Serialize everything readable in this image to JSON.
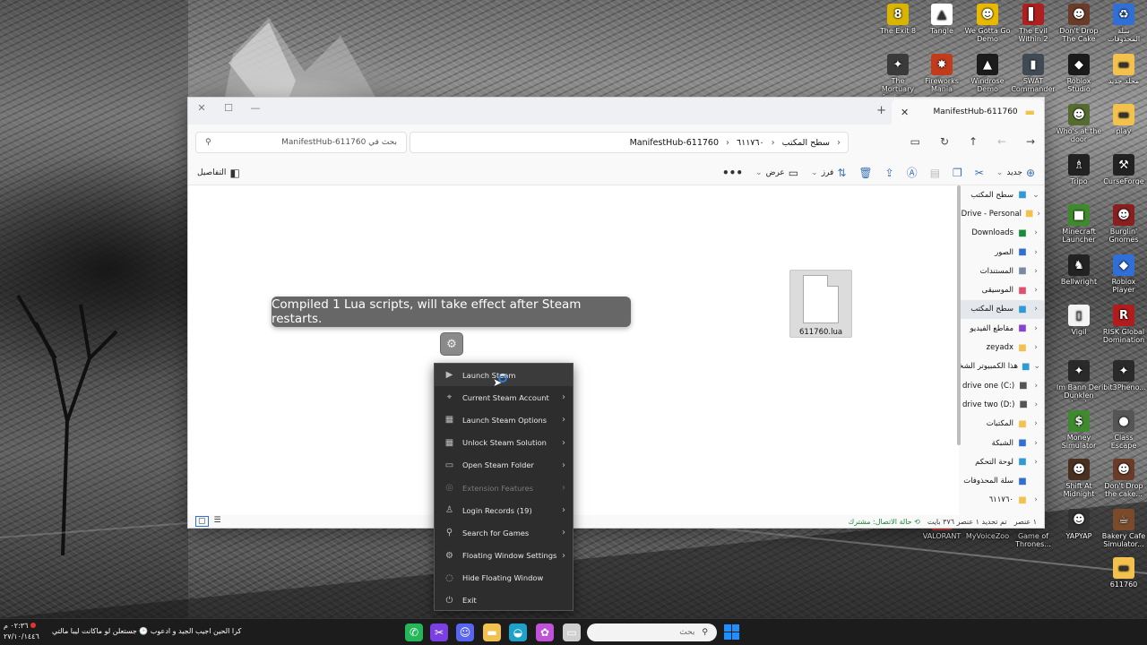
{
  "desktop": {
    "icons": [
      {
        "label": "The Exit 8",
        "glyph": "8",
        "color": "#d9b400",
        "col": 0,
        "row": 0
      },
      {
        "label": "Tangle",
        "glyph": "▲",
        "color": "#ffffff",
        "col": 1,
        "row": 0
      },
      {
        "label": "We Gotta Go Demo",
        "glyph": "☻",
        "color": "#e8b900",
        "col": 2,
        "row": 0
      },
      {
        "label": "The Evil Within 2",
        "glyph": "▌",
        "color": "#b01e1e",
        "col": 3,
        "row": 0
      },
      {
        "label": "Don't Drop The Cake",
        "glyph": "☻",
        "color": "#6b3b2a",
        "col": 4,
        "row": 0
      },
      {
        "label": "سلة المحذوفات",
        "glyph": "♻",
        "color": "#2f6fd6",
        "col": 5,
        "row": 0
      },
      {
        "label": "The Mortuary Assistant",
        "glyph": "✦",
        "color": "#3a3a3a",
        "col": 0,
        "row": 1
      },
      {
        "label": "Fireworks Mania",
        "glyph": "✸",
        "color": "#c23b1b",
        "col": 1,
        "row": 1
      },
      {
        "label": "Windrose Demo",
        "glyph": "▲",
        "color": "#1c1c1c",
        "col": 2,
        "row": 1
      },
      {
        "label": "SWAT Commander",
        "glyph": "▮",
        "color": "#3f4a55",
        "col": 3,
        "row": 1
      },
      {
        "label": "Roblox Studio",
        "glyph": "◆",
        "color": "#1b1b1b",
        "col": 4,
        "row": 1
      },
      {
        "label": "مجلد جديد",
        "glyph": "▬",
        "color": "#f2c14e",
        "col": 5,
        "row": 1
      },
      {
        "label": "Who's at the door",
        "glyph": "☻",
        "color": "#556b2f",
        "col": 4,
        "row": 2
      },
      {
        "label": "play",
        "glyph": "▬",
        "color": "#f2c14e",
        "col": 5,
        "row": 2
      },
      {
        "label": "Tripo",
        "glyph": "♗",
        "color": "#222222",
        "col": 4,
        "row": 3
      },
      {
        "label": "CurseForge",
        "glyph": "⚒",
        "color": "#222222",
        "col": 5,
        "row": 3
      },
      {
        "label": "Minecraft Launcher",
        "glyph": "■",
        "color": "#3e8a2c",
        "col": 4,
        "row": 4
      },
      {
        "label": "Burglin' Gnomes",
        "glyph": "☻",
        "color": "#8a1f1f",
        "col": 5,
        "row": 4
      },
      {
        "label": "Bellwright",
        "glyph": "♞",
        "color": "#222222",
        "col": 4,
        "row": 5
      },
      {
        "label": "Roblox Player",
        "glyph": "◆",
        "color": "#2f6fd6",
        "col": 5,
        "row": 5
      },
      {
        "label": "Vigil",
        "glyph": "▯",
        "color": "#f4f4f4",
        "col": 4,
        "row": 6
      },
      {
        "label": "RISK Global Domination",
        "glyph": "R",
        "color": "#b31c1c",
        "col": 5,
        "row": 6
      },
      {
        "label": "Im Bann Der Dunklen Jagd",
        "glyph": "✦",
        "color": "#2a2a2a",
        "col": 4,
        "row": 7
      },
      {
        "label": "ibit3Pheno...",
        "glyph": "✦",
        "color": "#2a2a2a",
        "col": 5,
        "row": 7
      },
      {
        "label": "Money Simulator",
        "glyph": "$",
        "color": "#3f8a2f",
        "col": 4,
        "row": 8
      },
      {
        "label": "Class Escape",
        "glyph": "●",
        "color": "#555555",
        "col": 5,
        "row": 8
      },
      {
        "label": "Shift At Midnight",
        "glyph": "☻",
        "color": "#4a3020",
        "col": 4,
        "row": 9
      },
      {
        "label": "Don't Drop the cake...",
        "glyph": "☻",
        "color": "#6b3b2a",
        "col": 5,
        "row": 9
      },
      {
        "label": "VALORANT",
        "glyph": "V",
        "color": "#d13b3b",
        "col": 1,
        "row": 10
      },
      {
        "label": "MyVoiceZoo",
        "glyph": "◉",
        "color": "#444444",
        "col": 2,
        "row": 10
      },
      {
        "label": "Game of Thrones...",
        "glyph": "♜",
        "color": "#333333",
        "col": 3,
        "row": 10
      },
      {
        "label": "YAPYAP",
        "glyph": "☻",
        "color": "#333333",
        "col": 4,
        "row": 10
      },
      {
        "label": "Bakery Cafe Simulator...",
        "glyph": "☕",
        "color": "#7a4a2a",
        "col": 5,
        "row": 10
      },
      {
        "label": "611760",
        "glyph": "▬",
        "color": "#f2c14e",
        "col": 5,
        "row": 11
      }
    ]
  },
  "explorer": {
    "tab_title": "ManifestHub-611760",
    "path_segments": [
      "سطح المكتب",
      "٦١١٧٦٠",
      "ManifestHub-611760"
    ],
    "search_placeholder": "بحث في ManifestHub-611760",
    "commandbar": {
      "new_label": "جديد",
      "sort_label": "فرز",
      "view_label": "عرض",
      "details_label": "التفاصيل"
    },
    "nav_items": [
      {
        "label": "سطح المكتب",
        "icon": "desktop-icon",
        "chev": "⌄",
        "color": "#2f9ad6",
        "selected": false
      },
      {
        "label": "OneDrive - Personal",
        "icon": "folder-icon",
        "chev": "‹",
        "color": "#f2c14e",
        "selected": false
      },
      {
        "label": "Downloads",
        "icon": "download-icon",
        "chev": "‹",
        "color": "#1c8a3c",
        "selected": false
      },
      {
        "label": "الصور",
        "icon": "pictures-icon",
        "chev": "‹",
        "color": "#2f6fd6",
        "selected": false
      },
      {
        "label": "المستندات",
        "icon": "documents-icon",
        "chev": "‹",
        "color": "#7a8aa0",
        "selected": false
      },
      {
        "label": "الموسيقى",
        "icon": "music-icon",
        "chev": "‹",
        "color": "#e0506b",
        "selected": false
      },
      {
        "label": "سطح المكتب",
        "icon": "desktop-icon",
        "chev": "‹",
        "color": "#2f9ad6",
        "selected": true
      },
      {
        "label": "مقاطع الفيديو",
        "icon": "video-icon",
        "chev": "‹",
        "color": "#8a3fd6",
        "selected": false
      },
      {
        "label": "zeyadx",
        "icon": "folder-icon",
        "chev": "‹",
        "color": "#f2c14e",
        "selected": false
      },
      {
        "label": "هذا الكمبيوتر الشخصي",
        "icon": "pc-icon",
        "chev": "⌄",
        "color": "#2f9ad6",
        "selected": false
      },
      {
        "label": "drive one (C:)",
        "icon": "drive-icon",
        "chev": "‹",
        "color": "#555555",
        "selected": false
      },
      {
        "label": "drive two (D:)",
        "icon": "drive-icon",
        "chev": "‹",
        "color": "#555555",
        "selected": false
      },
      {
        "label": "المكتبات",
        "icon": "folder-icon",
        "chev": "‹",
        "color": "#f2c14e",
        "selected": false
      },
      {
        "label": "الشبكة",
        "icon": "network-icon",
        "chev": "‹",
        "color": "#2f6fd6",
        "selected": false
      },
      {
        "label": "لوحة التحكم",
        "icon": "control-panel-icon",
        "chev": "‹",
        "color": "#2f9ad6",
        "selected": false
      },
      {
        "label": "سلة المحذوفات",
        "icon": "recycle-bin-icon",
        "chev": "",
        "color": "#2f6fd6",
        "selected": false
      },
      {
        "label": "٦١١٧٦٠",
        "icon": "folder-icon",
        "chev": "‹",
        "color": "#f2c14e",
        "selected": false
      }
    ],
    "file": {
      "name": "611760.lua"
    },
    "status": {
      "count": "١ عنصر",
      "selected": "تم تحديد ١ عنصر  ٣٧٦ بايت",
      "connection": "حالة الاتصال: مشترك"
    }
  },
  "toast": {
    "text": "Compiled 1 Lua scripts, will take effect after Steam restarts."
  },
  "context_menu": {
    "items": [
      {
        "label": "Launch Steam",
        "icon": "play-icon",
        "glyph": "▶",
        "submenu": false,
        "disabled": false,
        "hover": true
      },
      {
        "label": "Current Steam Account",
        "icon": "location-pin-icon",
        "glyph": "⌖",
        "submenu": true,
        "disabled": false,
        "hover": false
      },
      {
        "label": "Launch Steam Options",
        "icon": "grid-icon",
        "glyph": "▦",
        "submenu": true,
        "disabled": false,
        "hover": false
      },
      {
        "label": "Unlock Steam Solution",
        "icon": "grid-icon",
        "glyph": "▦",
        "submenu": true,
        "disabled": false,
        "hover": false
      },
      {
        "label": "Open Steam Folder",
        "icon": "folder-icon",
        "glyph": "▭",
        "submenu": true,
        "disabled": false,
        "hover": false
      },
      {
        "label": "Extension Features",
        "icon": "extension-icon",
        "glyph": "◎",
        "submenu": true,
        "disabled": true,
        "hover": false
      },
      {
        "label": "Login Records (19)",
        "icon": "user-icon",
        "glyph": "♙",
        "submenu": true,
        "disabled": false,
        "hover": false
      },
      {
        "label": "Search for Games",
        "icon": "search-icon",
        "glyph": "⚲",
        "submenu": true,
        "disabled": false,
        "hover": false
      },
      {
        "label": "Floating Window Settings",
        "icon": "gear-icon",
        "glyph": "⚙",
        "submenu": true,
        "disabled": false,
        "hover": false
      },
      {
        "label": "Hide Floating Window",
        "icon": "eye-off-icon",
        "glyph": "◌",
        "submenu": false,
        "disabled": false,
        "hover": false
      },
      {
        "label": "Exit",
        "icon": "power-icon",
        "glyph": "⏻",
        "submenu": false,
        "disabled": false,
        "hover": false
      }
    ]
  },
  "taskbar": {
    "search_placeholder": "بحث",
    "news_text": "كرا الحين اجيب الجيد و ادعوب 🕑 جستعلن لو ماكانت ليبا مالتي",
    "clock_time": "٠٢:٣٦ م",
    "clock_date": "٢٧/١٠/١٤٤٦",
    "apps": [
      {
        "name": "whatsapp-icon",
        "glyph": "✆",
        "color": "#25b65a"
      },
      {
        "name": "tools-icon",
        "glyph": "✂",
        "color": "#7b3fe4"
      },
      {
        "name": "discord-icon",
        "glyph": "☺",
        "color": "#5865f2"
      },
      {
        "name": "file-explorer-icon",
        "glyph": "▬",
        "color": "#f2c14e"
      },
      {
        "name": "edge-icon",
        "glyph": "◒",
        "color": "#1fa2c9"
      },
      {
        "name": "copilot-icon",
        "glyph": "✿",
        "color": "#c052d8"
      },
      {
        "name": "window-icon",
        "glyph": "▭",
        "color": "#cfcfcf"
      }
    ]
  }
}
